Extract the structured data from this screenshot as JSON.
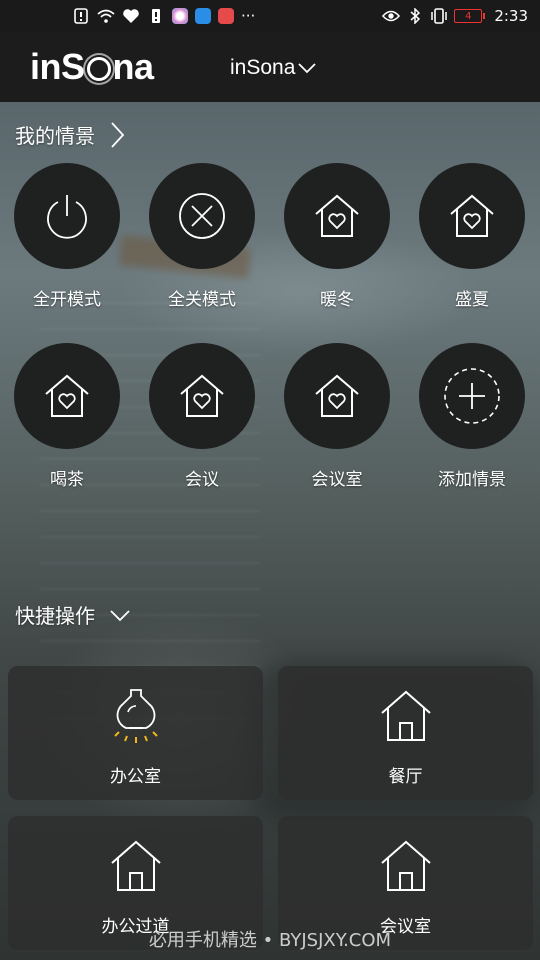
{
  "status_bar": {
    "time": "2:33",
    "battery_level": "4",
    "overflow": "···"
  },
  "header": {
    "logo": "inSona",
    "home_name": "inSona"
  },
  "scenes_section": {
    "title": "我的情景",
    "items": [
      {
        "label": "全开模式",
        "icon": "power-icon"
      },
      {
        "label": "全关模式",
        "icon": "close-circle-icon"
      },
      {
        "label": "暖冬",
        "icon": "home-heart-icon"
      },
      {
        "label": "盛夏",
        "icon": "home-heart-icon"
      },
      {
        "label": "喝茶",
        "icon": "home-heart-icon"
      },
      {
        "label": "会议",
        "icon": "home-heart-icon"
      },
      {
        "label": "会议室",
        "icon": "home-heart-icon"
      },
      {
        "label": "添加情景",
        "icon": "add-dashed-icon"
      }
    ]
  },
  "quick_section": {
    "title": "快捷操作",
    "items": [
      {
        "label": "办公室",
        "icon": "lamp-on-icon"
      },
      {
        "label": "餐厅",
        "icon": "house-icon"
      },
      {
        "label": "办公过道",
        "icon": "house-icon"
      },
      {
        "label": "会议室",
        "icon": "house-icon"
      }
    ]
  },
  "watermark": "必用手机精选 • BYJSJXY.COM",
  "colors": {
    "accent_lamp": "#f2b51c",
    "battery_low": "#e33333",
    "circle_bg": "#1f2020"
  }
}
